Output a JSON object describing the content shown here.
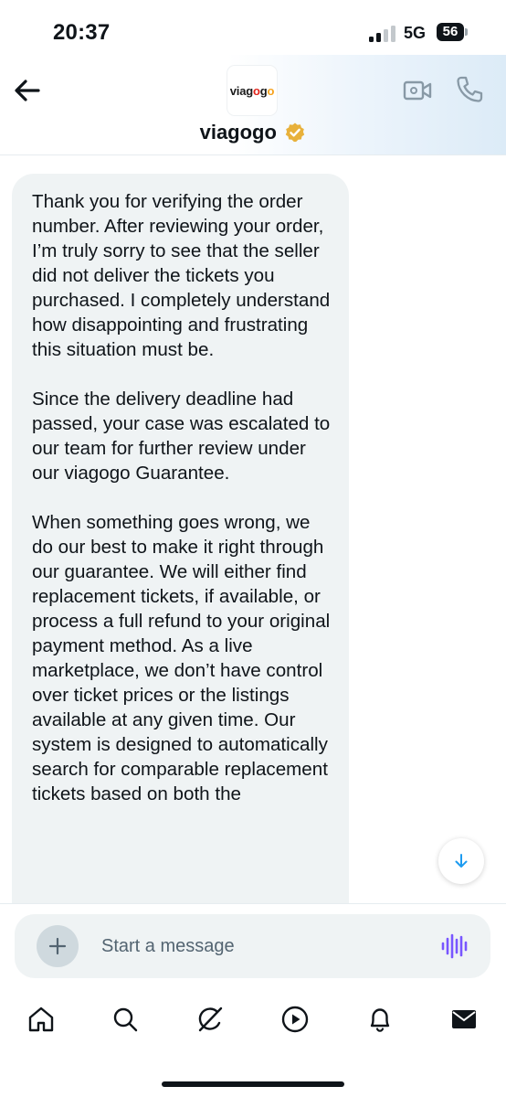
{
  "status_bar": {
    "time": "20:37",
    "network": "5G",
    "battery": "56"
  },
  "header": {
    "avatar_logo": {
      "part1": "viag",
      "part2": "o",
      "part3": "g",
      "part4": "o",
      "part5": "go"
    },
    "chat_name": "viagogo",
    "icons": {
      "back": "arrow-left-icon",
      "verified": "verified-badge-icon",
      "video": "video-call-icon",
      "call": "phone-icon"
    }
  },
  "message": {
    "paragraphs": [
      "Thank you for verifying the order number. After reviewing your order, I’m truly sorry to see that the seller did not deliver the tickets you purchased. I completely understand how disappointing and frustrating this situation must be.",
      "Since the delivery deadline had passed, your case was escalated to our team for further review under our viagogo Guarantee.",
      "When something goes wrong, we do our best to make it right through our guarantee. We will either find replacement tickets, if available, or process a full refund to your original payment method. As a live marketplace, we don’t have control over ticket prices or the listings available at any given time. Our system is designed to automatically search for comparable replacement tickets based on both the"
    ]
  },
  "composer": {
    "placeholder": "Start a message",
    "icons": {
      "add": "plus-icon",
      "voice": "voice-wave-icon",
      "scroll": "arrow-down-icon"
    }
  },
  "tab_bar": {
    "items": [
      "home-icon",
      "search-icon",
      "grok-icon",
      "video-play-icon",
      "notifications-bell-icon",
      "messages-envelope-icon"
    ]
  },
  "colors": {
    "bubble": "#eff3f4",
    "verified": "#e8b13b",
    "accent_blue": "#1d9bf0",
    "voice_purple": "#7856ff"
  }
}
